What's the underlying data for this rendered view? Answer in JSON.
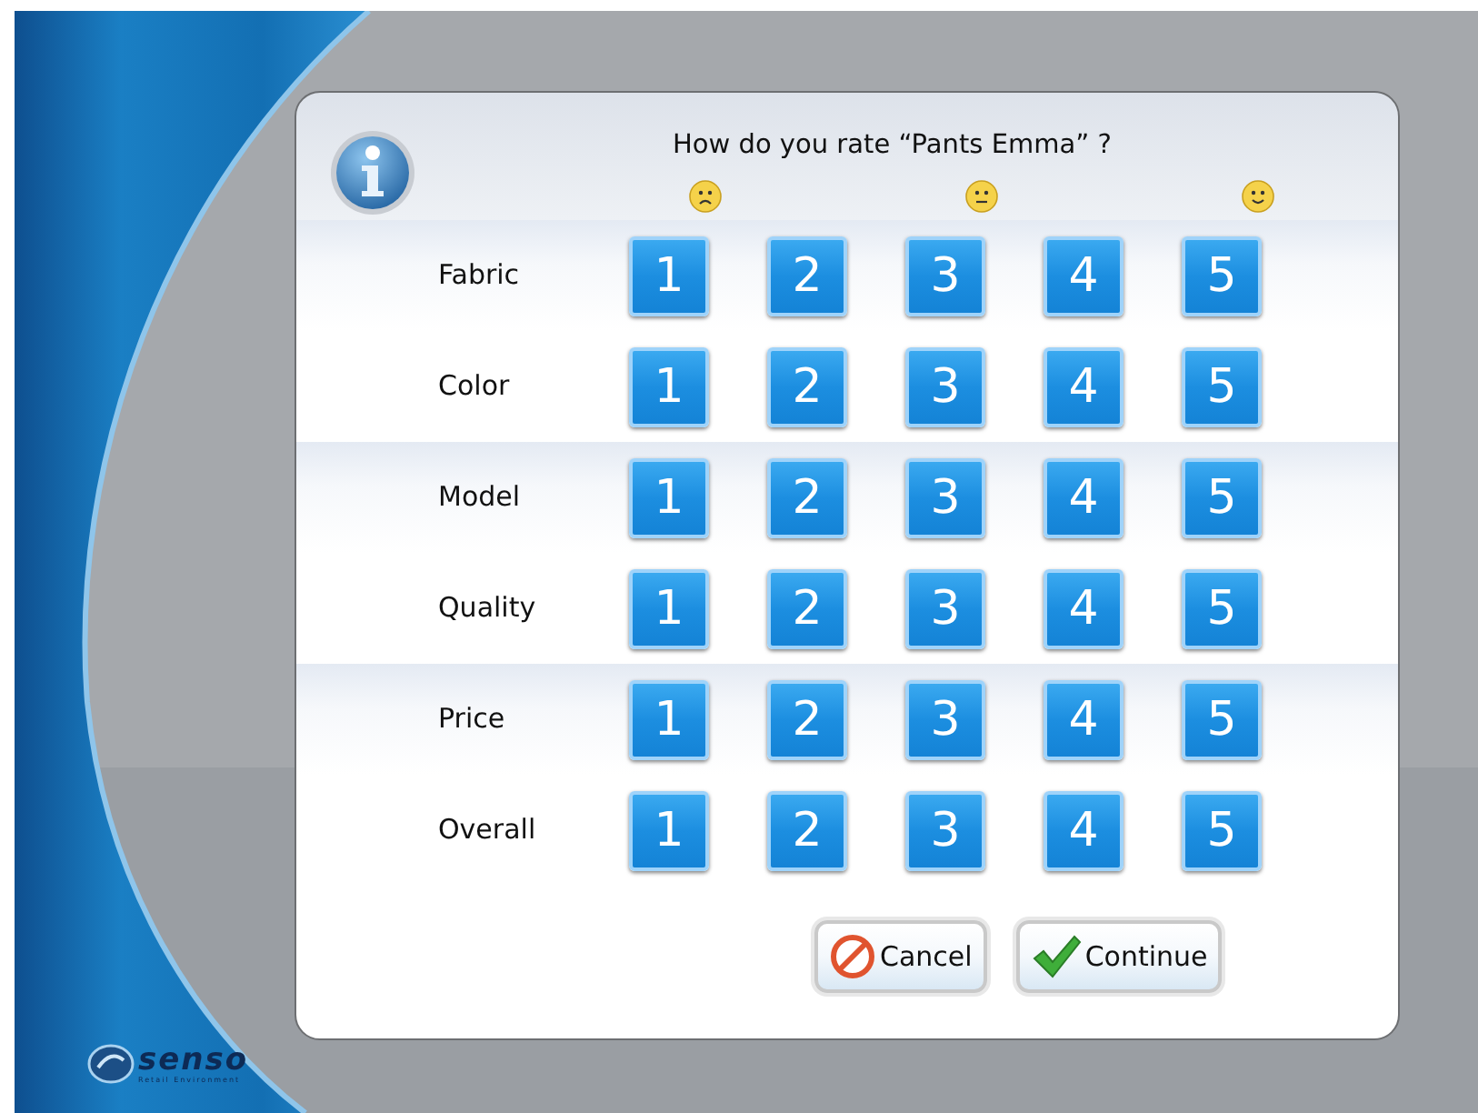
{
  "dialog": {
    "title": "How do you rate “Pants Emma” ?",
    "faces": [
      {
        "kind": "sad"
      },
      {
        "kind": "none"
      },
      {
        "kind": "neutral"
      },
      {
        "kind": "none"
      },
      {
        "kind": "happy"
      }
    ],
    "rows": [
      {
        "label": "Fabric",
        "options": [
          "1",
          "2",
          "3",
          "4",
          "5"
        ]
      },
      {
        "label": "Color",
        "options": [
          "1",
          "2",
          "3",
          "4",
          "5"
        ]
      },
      {
        "label": "Model",
        "options": [
          "1",
          "2",
          "3",
          "4",
          "5"
        ]
      },
      {
        "label": "Quality",
        "options": [
          "1",
          "2",
          "3",
          "4",
          "5"
        ]
      },
      {
        "label": "Price",
        "options": [
          "1",
          "2",
          "3",
          "4",
          "5"
        ]
      },
      {
        "label": "Overall",
        "options": [
          "1",
          "2",
          "3",
          "4",
          "5"
        ]
      }
    ],
    "buttons": [
      {
        "kind": "cancel",
        "label": "Cancel"
      },
      {
        "kind": "continue",
        "label": "Continue"
      }
    ]
  },
  "logo": {
    "name": "senso",
    "tagline": "Retail Environment"
  }
}
